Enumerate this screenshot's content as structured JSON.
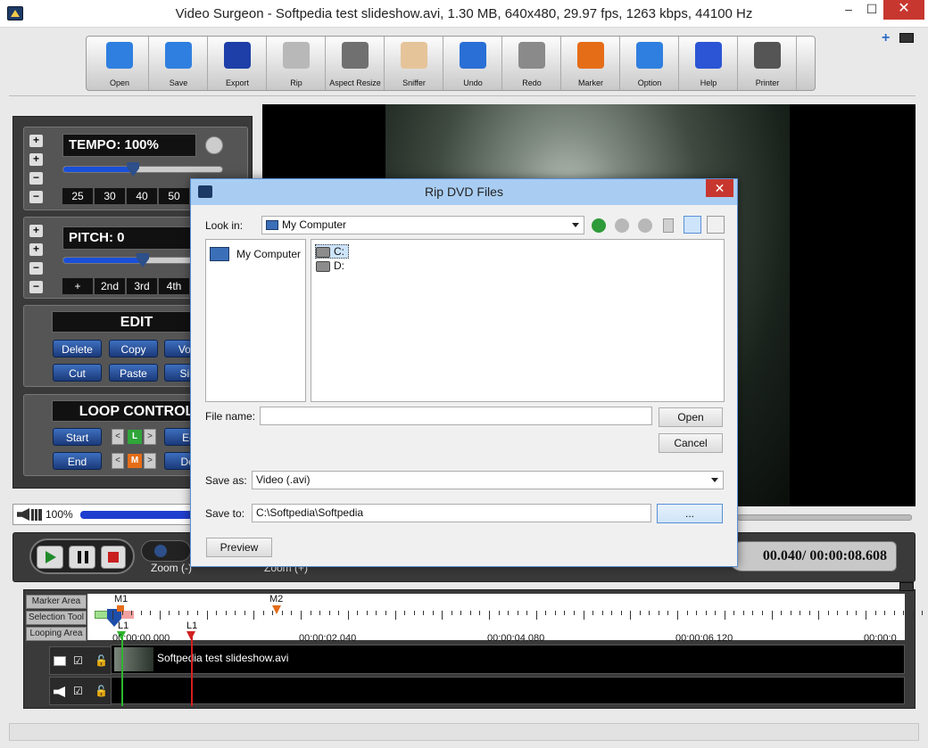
{
  "window": {
    "title": "Video Surgeon - Softpedia test slideshow.avi, 1.30 MB, 640x480, 29.97 fps, 1263 kbps, 44100 Hz",
    "minimize": "–",
    "maximize": "☐",
    "close": "✕"
  },
  "toolbar": {
    "items": [
      {
        "label": "Open",
        "icon": "folder-icon",
        "color": "#2f7fe0"
      },
      {
        "label": "Save",
        "icon": "save-icon",
        "color": "#2f7fe0"
      },
      {
        "label": "Export",
        "icon": "export-icon",
        "color": "#1e3fa8"
      },
      {
        "label": "Rip",
        "icon": "disc-icon",
        "color": "#b8b8b8"
      },
      {
        "label": "Aspect Resize",
        "icon": "aspect-resize-icon",
        "color": "#707070"
      },
      {
        "label": "Sniffer",
        "icon": "nose-icon",
        "color": "#e6c49a"
      },
      {
        "label": "Undo",
        "icon": "undo-icon",
        "color": "#2a6fd6"
      },
      {
        "label": "Redo",
        "icon": "redo-icon",
        "color": "#8a8a8a"
      },
      {
        "label": "Marker",
        "icon": "marker-icon",
        "color": "#e56d18"
      },
      {
        "label": "Option",
        "icon": "option-icon",
        "color": "#2f7fe0"
      },
      {
        "label": "Help",
        "icon": "help-icon",
        "color": "#2b55d4"
      },
      {
        "label": "Printer",
        "icon": "printer-icon",
        "color": "#555555"
      }
    ]
  },
  "tempo": {
    "label": "TEMPO: 100%",
    "plus": "+",
    "minus": "−",
    "level": 0.44,
    "presets": [
      "25",
      "30",
      "40",
      "50"
    ]
  },
  "pitch": {
    "label": "PITCH: 0",
    "plus": "+",
    "minus": "−",
    "level": 0.5,
    "presets": [
      "+",
      "2nd",
      "3rd",
      "4th"
    ]
  },
  "edit": {
    "title": "EDIT",
    "buttons": [
      "Delete",
      "Copy",
      "Volu",
      "Cut",
      "Paste",
      "Sile"
    ]
  },
  "loop": {
    "title": "LOOP CONTROL",
    "start": "Start",
    "end": "End",
    "edge1": "Ed",
    "edge2": "Del",
    "l_badge": "L",
    "m_badge": "M"
  },
  "volume": {
    "value": "100%",
    "level": 1.0
  },
  "player": {
    "zoom_minus": "Zoom (-)",
    "zoom_plus": "Zoom (+)",
    "time": "00.040/ 00:00:08.608"
  },
  "timeline": {
    "labels": [
      "Marker Area",
      "Selection Tool",
      "Looping Area"
    ],
    "markers": [
      "M1",
      "M2"
    ],
    "loops": [
      "L1",
      "L1"
    ],
    "times": [
      "00:00:00.000",
      "00:00:02.040",
      "00:00:04.080",
      "00:00:06.120",
      "00:00:0"
    ],
    "clip_name": "Softpedia test slideshow.avi"
  },
  "dialog": {
    "title": "Rip DVD Files",
    "close": "✕",
    "look_in_label": "Look in:",
    "look_in_value": "My Computer",
    "places": [
      "My Computer"
    ],
    "drives": [
      "C:",
      "D:"
    ],
    "file_name_label": "File name:",
    "file_name_value": "",
    "open": "Open",
    "cancel": "Cancel",
    "save_as_label": "Save as:",
    "save_as_value": "Video (.avi)",
    "save_to_label": "Save to:",
    "save_to_value": "C:\\Softpedia\\Softpedia",
    "browse": "...",
    "preview": "Preview"
  },
  "colors": {
    "accent": "#1a4fd8",
    "dialog_title": "#a9cdf2",
    "close_red": "#c7372f"
  }
}
